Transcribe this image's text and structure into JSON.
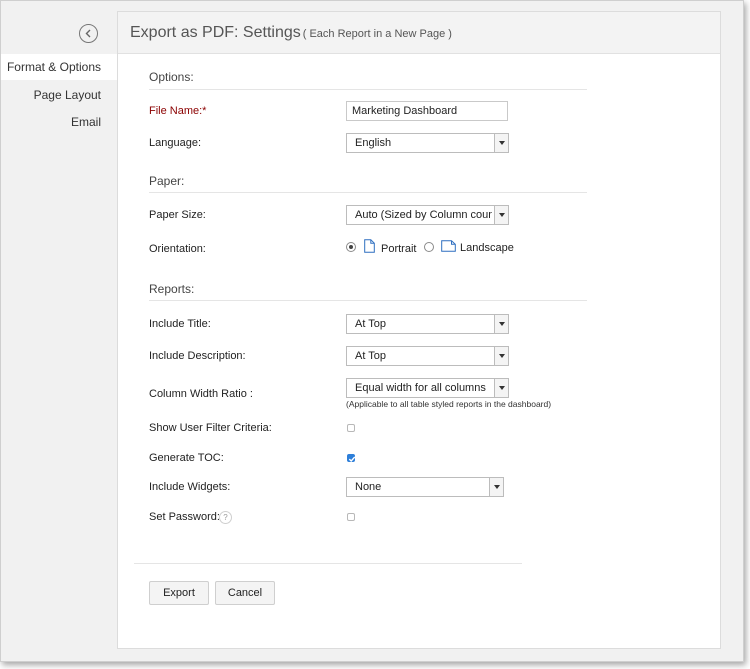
{
  "sidebar": {
    "items": [
      {
        "label": "Format & Options",
        "active": true
      },
      {
        "label": "Page Layout",
        "active": false
      },
      {
        "label": "Email",
        "active": false
      }
    ]
  },
  "header": {
    "title": "Export as PDF: Settings",
    "subtitle": "( Each Report in a New Page )"
  },
  "options": {
    "section_title": "Options:",
    "file_name_label": "File Name:*",
    "file_name_value": "Marketing Dashboard",
    "language_label": "Language:",
    "language_value": "English"
  },
  "paper": {
    "section_title": "Paper:",
    "paper_size_label": "Paper Size:",
    "paper_size_value": "Auto (Sized by Column count)",
    "orientation_label": "Orientation:",
    "portrait_label": "Portrait",
    "landscape_label": "Landscape",
    "orientation_selected": "Portrait"
  },
  "reports": {
    "section_title": "Reports:",
    "include_title_label": "Include Title:",
    "include_title_value": "At Top",
    "include_description_label": "Include Description:",
    "include_description_value": "At Top",
    "column_width_label": "Column Width Ratio :",
    "column_width_value": "Equal width for all columns",
    "column_width_hint": "(Applicable to all table styled reports in the dashboard)",
    "show_filter_label": "Show User Filter Criteria:",
    "show_filter_checked": false,
    "generate_toc_label": "Generate TOC:",
    "generate_toc_checked": true,
    "include_widgets_label": "Include Widgets:",
    "include_widgets_value": "None",
    "set_password_label": "Set Password:",
    "set_password_checked": false,
    "help_glyph": "?"
  },
  "footer": {
    "export_label": "Export",
    "cancel_label": "Cancel"
  },
  "colors": {
    "required_label": "#8b0000",
    "checkbox_checked": "#2e7fd9",
    "sidebar_bg": "#f1f1f1",
    "header_bg": "#f3f3f3"
  }
}
